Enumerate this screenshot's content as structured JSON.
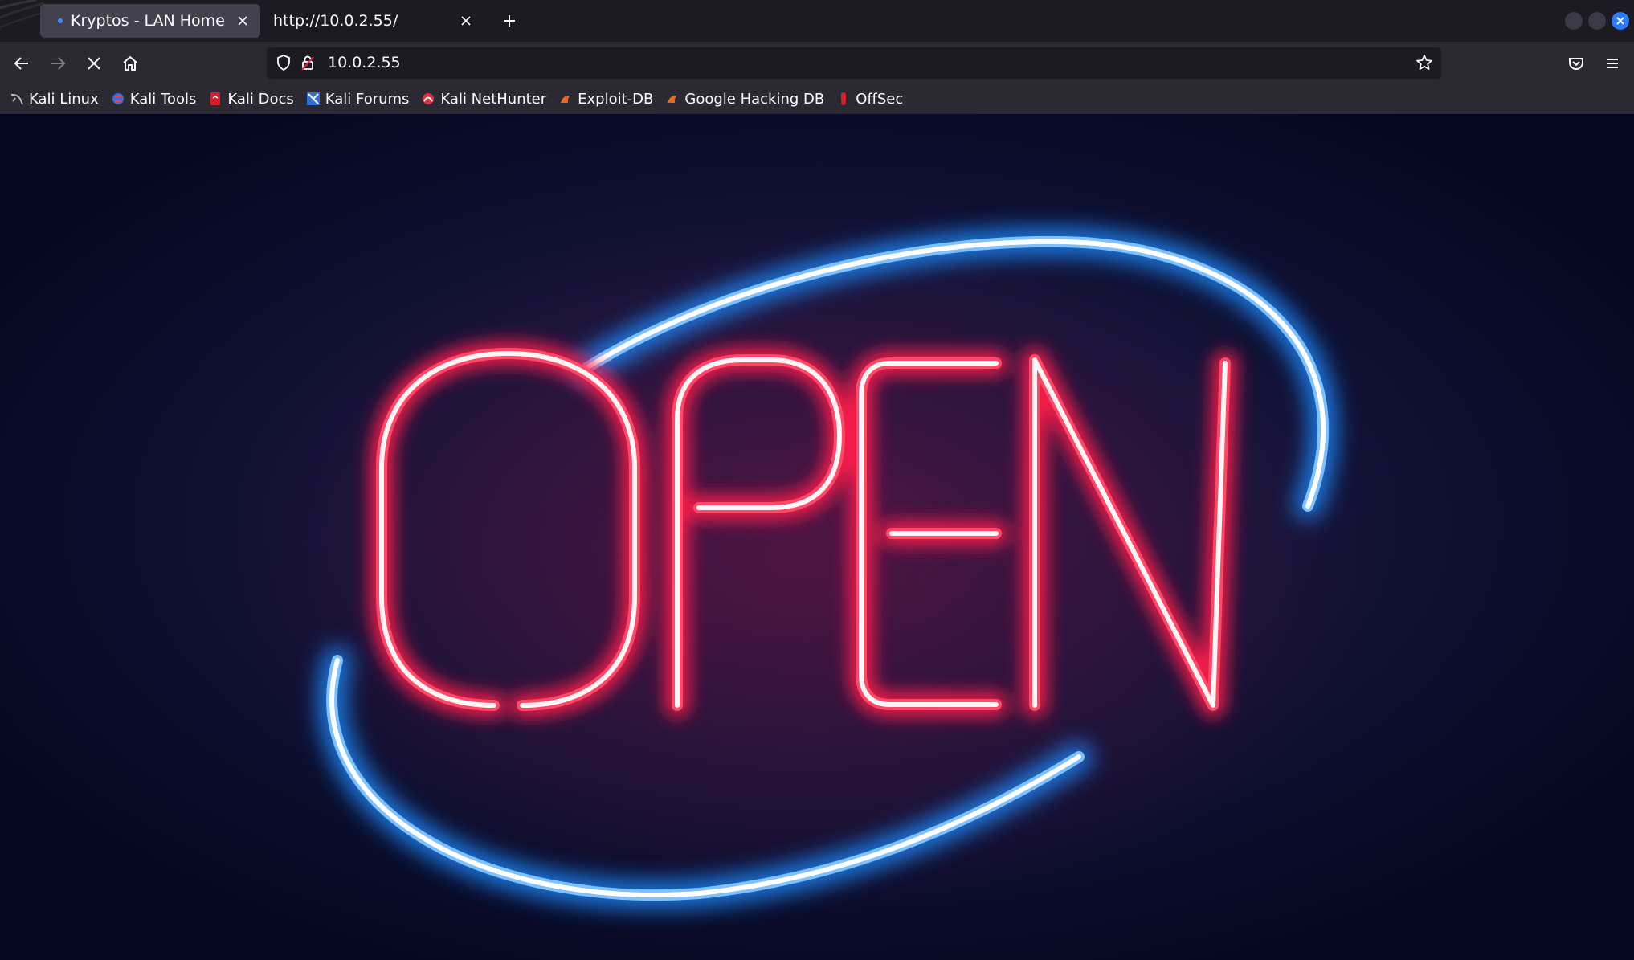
{
  "tabs": [
    {
      "title": "Kryptos - LAN Home",
      "active": true
    },
    {
      "title": "http://10.0.2.55/",
      "active": false
    }
  ],
  "urlbar": {
    "url": "10.0.2.55"
  },
  "bookmarks": [
    {
      "label": "Kali Linux",
      "icon": "kali-linux-icon"
    },
    {
      "label": "Kali Tools",
      "icon": "kali-tools-icon"
    },
    {
      "label": "Kali Docs",
      "icon": "kali-docs-icon"
    },
    {
      "label": "Kali Forums",
      "icon": "kali-forums-icon"
    },
    {
      "label": "Kali NetHunter",
      "icon": "kali-nethunter-icon"
    },
    {
      "label": "Exploit-DB",
      "icon": "exploit-db-icon"
    },
    {
      "label": "Google Hacking DB",
      "icon": "ghdb-icon"
    },
    {
      "label": "OffSec",
      "icon": "offsec-icon"
    }
  ],
  "page": {
    "sign_text": "OPEN"
  },
  "colors": {
    "chrome_bg": "#1c1b22",
    "toolbar_bg": "#2b2a33",
    "active_tab": "#42414d",
    "neon_red": "#ff1f4b",
    "neon_blue": "#1e8bff",
    "accent": "#2a7bff"
  }
}
